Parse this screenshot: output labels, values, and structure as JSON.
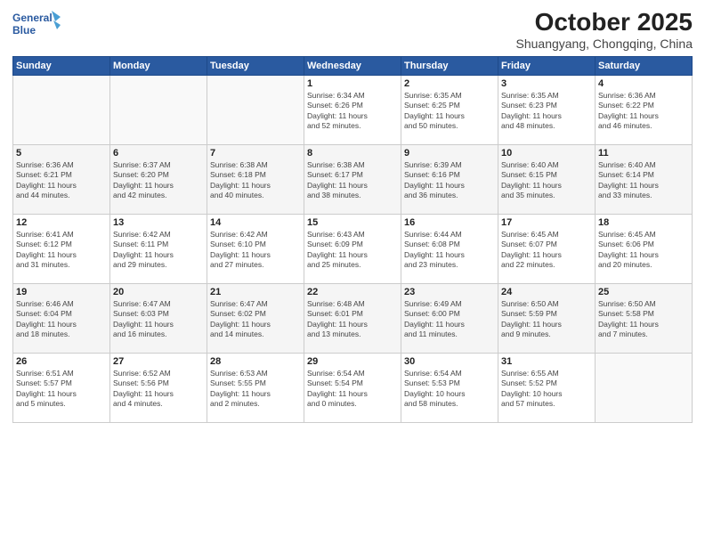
{
  "header": {
    "logo_line1": "General",
    "logo_line2": "Blue",
    "month": "October 2025",
    "location": "Shuangyang, Chongqing, China"
  },
  "weekdays": [
    "Sunday",
    "Monday",
    "Tuesday",
    "Wednesday",
    "Thursday",
    "Friday",
    "Saturday"
  ],
  "weeks": [
    [
      {
        "num": "",
        "info": ""
      },
      {
        "num": "",
        "info": ""
      },
      {
        "num": "",
        "info": ""
      },
      {
        "num": "1",
        "info": "Sunrise: 6:34 AM\nSunset: 6:26 PM\nDaylight: 11 hours\nand 52 minutes."
      },
      {
        "num": "2",
        "info": "Sunrise: 6:35 AM\nSunset: 6:25 PM\nDaylight: 11 hours\nand 50 minutes."
      },
      {
        "num": "3",
        "info": "Sunrise: 6:35 AM\nSunset: 6:23 PM\nDaylight: 11 hours\nand 48 minutes."
      },
      {
        "num": "4",
        "info": "Sunrise: 6:36 AM\nSunset: 6:22 PM\nDaylight: 11 hours\nand 46 minutes."
      }
    ],
    [
      {
        "num": "5",
        "info": "Sunrise: 6:36 AM\nSunset: 6:21 PM\nDaylight: 11 hours\nand 44 minutes."
      },
      {
        "num": "6",
        "info": "Sunrise: 6:37 AM\nSunset: 6:20 PM\nDaylight: 11 hours\nand 42 minutes."
      },
      {
        "num": "7",
        "info": "Sunrise: 6:38 AM\nSunset: 6:18 PM\nDaylight: 11 hours\nand 40 minutes."
      },
      {
        "num": "8",
        "info": "Sunrise: 6:38 AM\nSunset: 6:17 PM\nDaylight: 11 hours\nand 38 minutes."
      },
      {
        "num": "9",
        "info": "Sunrise: 6:39 AM\nSunset: 6:16 PM\nDaylight: 11 hours\nand 36 minutes."
      },
      {
        "num": "10",
        "info": "Sunrise: 6:40 AM\nSunset: 6:15 PM\nDaylight: 11 hours\nand 35 minutes."
      },
      {
        "num": "11",
        "info": "Sunrise: 6:40 AM\nSunset: 6:14 PM\nDaylight: 11 hours\nand 33 minutes."
      }
    ],
    [
      {
        "num": "12",
        "info": "Sunrise: 6:41 AM\nSunset: 6:12 PM\nDaylight: 11 hours\nand 31 minutes."
      },
      {
        "num": "13",
        "info": "Sunrise: 6:42 AM\nSunset: 6:11 PM\nDaylight: 11 hours\nand 29 minutes."
      },
      {
        "num": "14",
        "info": "Sunrise: 6:42 AM\nSunset: 6:10 PM\nDaylight: 11 hours\nand 27 minutes."
      },
      {
        "num": "15",
        "info": "Sunrise: 6:43 AM\nSunset: 6:09 PM\nDaylight: 11 hours\nand 25 minutes."
      },
      {
        "num": "16",
        "info": "Sunrise: 6:44 AM\nSunset: 6:08 PM\nDaylight: 11 hours\nand 23 minutes."
      },
      {
        "num": "17",
        "info": "Sunrise: 6:45 AM\nSunset: 6:07 PM\nDaylight: 11 hours\nand 22 minutes."
      },
      {
        "num": "18",
        "info": "Sunrise: 6:45 AM\nSunset: 6:06 PM\nDaylight: 11 hours\nand 20 minutes."
      }
    ],
    [
      {
        "num": "19",
        "info": "Sunrise: 6:46 AM\nSunset: 6:04 PM\nDaylight: 11 hours\nand 18 minutes."
      },
      {
        "num": "20",
        "info": "Sunrise: 6:47 AM\nSunset: 6:03 PM\nDaylight: 11 hours\nand 16 minutes."
      },
      {
        "num": "21",
        "info": "Sunrise: 6:47 AM\nSunset: 6:02 PM\nDaylight: 11 hours\nand 14 minutes."
      },
      {
        "num": "22",
        "info": "Sunrise: 6:48 AM\nSunset: 6:01 PM\nDaylight: 11 hours\nand 13 minutes."
      },
      {
        "num": "23",
        "info": "Sunrise: 6:49 AM\nSunset: 6:00 PM\nDaylight: 11 hours\nand 11 minutes."
      },
      {
        "num": "24",
        "info": "Sunrise: 6:50 AM\nSunset: 5:59 PM\nDaylight: 11 hours\nand 9 minutes."
      },
      {
        "num": "25",
        "info": "Sunrise: 6:50 AM\nSunset: 5:58 PM\nDaylight: 11 hours\nand 7 minutes."
      }
    ],
    [
      {
        "num": "26",
        "info": "Sunrise: 6:51 AM\nSunset: 5:57 PM\nDaylight: 11 hours\nand 5 minutes."
      },
      {
        "num": "27",
        "info": "Sunrise: 6:52 AM\nSunset: 5:56 PM\nDaylight: 11 hours\nand 4 minutes."
      },
      {
        "num": "28",
        "info": "Sunrise: 6:53 AM\nSunset: 5:55 PM\nDaylight: 11 hours\nand 2 minutes."
      },
      {
        "num": "29",
        "info": "Sunrise: 6:54 AM\nSunset: 5:54 PM\nDaylight: 11 hours\nand 0 minutes."
      },
      {
        "num": "30",
        "info": "Sunrise: 6:54 AM\nSunset: 5:53 PM\nDaylight: 10 hours\nand 58 minutes."
      },
      {
        "num": "31",
        "info": "Sunrise: 6:55 AM\nSunset: 5:52 PM\nDaylight: 10 hours\nand 57 minutes."
      },
      {
        "num": "",
        "info": ""
      }
    ]
  ]
}
